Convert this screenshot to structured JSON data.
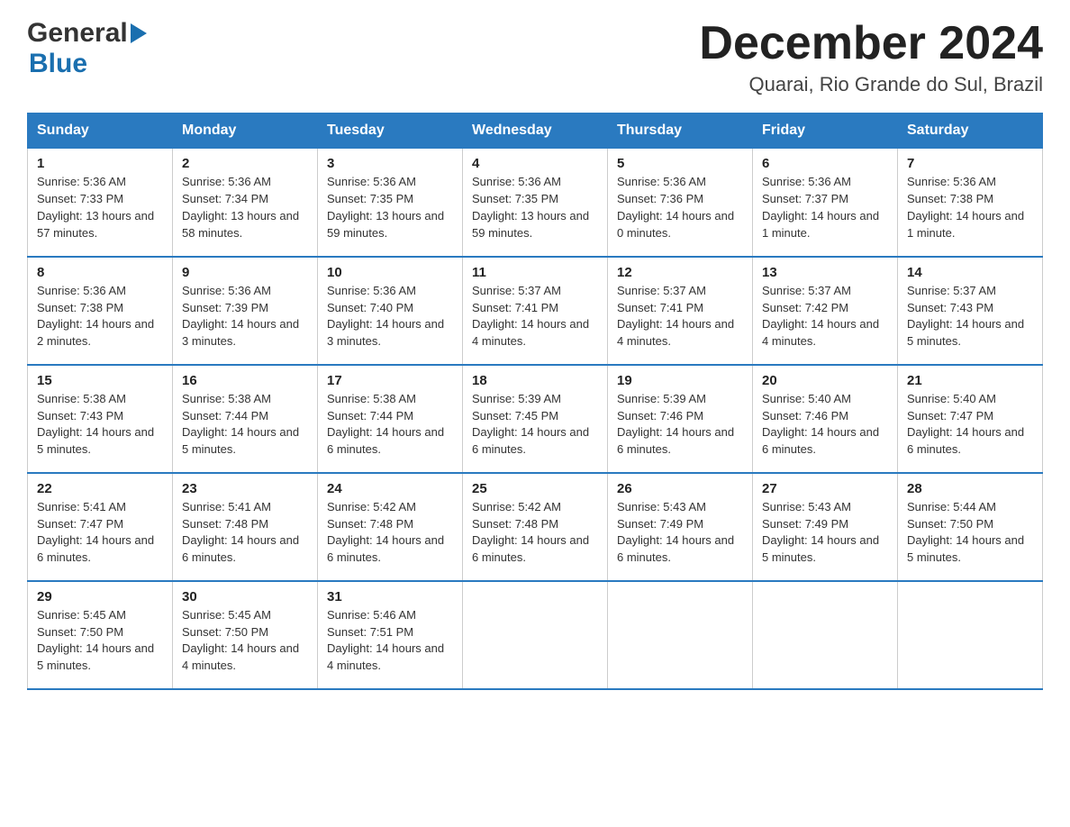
{
  "header": {
    "logo_general": "General",
    "logo_blue": "Blue",
    "month_title": "December 2024",
    "location": "Quarai, Rio Grande do Sul, Brazil"
  },
  "days_of_week": [
    "Sunday",
    "Monday",
    "Tuesday",
    "Wednesday",
    "Thursday",
    "Friday",
    "Saturday"
  ],
  "weeks": [
    [
      {
        "day": "1",
        "sunrise": "5:36 AM",
        "sunset": "7:33 PM",
        "daylight": "13 hours and 57 minutes."
      },
      {
        "day": "2",
        "sunrise": "5:36 AM",
        "sunset": "7:34 PM",
        "daylight": "13 hours and 58 minutes."
      },
      {
        "day": "3",
        "sunrise": "5:36 AM",
        "sunset": "7:35 PM",
        "daylight": "13 hours and 59 minutes."
      },
      {
        "day": "4",
        "sunrise": "5:36 AM",
        "sunset": "7:35 PM",
        "daylight": "13 hours and 59 minutes."
      },
      {
        "day": "5",
        "sunrise": "5:36 AM",
        "sunset": "7:36 PM",
        "daylight": "14 hours and 0 minutes."
      },
      {
        "day": "6",
        "sunrise": "5:36 AM",
        "sunset": "7:37 PM",
        "daylight": "14 hours and 1 minute."
      },
      {
        "day": "7",
        "sunrise": "5:36 AM",
        "sunset": "7:38 PM",
        "daylight": "14 hours and 1 minute."
      }
    ],
    [
      {
        "day": "8",
        "sunrise": "5:36 AM",
        "sunset": "7:38 PM",
        "daylight": "14 hours and 2 minutes."
      },
      {
        "day": "9",
        "sunrise": "5:36 AM",
        "sunset": "7:39 PM",
        "daylight": "14 hours and 3 minutes."
      },
      {
        "day": "10",
        "sunrise": "5:36 AM",
        "sunset": "7:40 PM",
        "daylight": "14 hours and 3 minutes."
      },
      {
        "day": "11",
        "sunrise": "5:37 AM",
        "sunset": "7:41 PM",
        "daylight": "14 hours and 4 minutes."
      },
      {
        "day": "12",
        "sunrise": "5:37 AM",
        "sunset": "7:41 PM",
        "daylight": "14 hours and 4 minutes."
      },
      {
        "day": "13",
        "sunrise": "5:37 AM",
        "sunset": "7:42 PM",
        "daylight": "14 hours and 4 minutes."
      },
      {
        "day": "14",
        "sunrise": "5:37 AM",
        "sunset": "7:43 PM",
        "daylight": "14 hours and 5 minutes."
      }
    ],
    [
      {
        "day": "15",
        "sunrise": "5:38 AM",
        "sunset": "7:43 PM",
        "daylight": "14 hours and 5 minutes."
      },
      {
        "day": "16",
        "sunrise": "5:38 AM",
        "sunset": "7:44 PM",
        "daylight": "14 hours and 5 minutes."
      },
      {
        "day": "17",
        "sunrise": "5:38 AM",
        "sunset": "7:44 PM",
        "daylight": "14 hours and 6 minutes."
      },
      {
        "day": "18",
        "sunrise": "5:39 AM",
        "sunset": "7:45 PM",
        "daylight": "14 hours and 6 minutes."
      },
      {
        "day": "19",
        "sunrise": "5:39 AM",
        "sunset": "7:46 PM",
        "daylight": "14 hours and 6 minutes."
      },
      {
        "day": "20",
        "sunrise": "5:40 AM",
        "sunset": "7:46 PM",
        "daylight": "14 hours and 6 minutes."
      },
      {
        "day": "21",
        "sunrise": "5:40 AM",
        "sunset": "7:47 PM",
        "daylight": "14 hours and 6 minutes."
      }
    ],
    [
      {
        "day": "22",
        "sunrise": "5:41 AM",
        "sunset": "7:47 PM",
        "daylight": "14 hours and 6 minutes."
      },
      {
        "day": "23",
        "sunrise": "5:41 AM",
        "sunset": "7:48 PM",
        "daylight": "14 hours and 6 minutes."
      },
      {
        "day": "24",
        "sunrise": "5:42 AM",
        "sunset": "7:48 PM",
        "daylight": "14 hours and 6 minutes."
      },
      {
        "day": "25",
        "sunrise": "5:42 AM",
        "sunset": "7:48 PM",
        "daylight": "14 hours and 6 minutes."
      },
      {
        "day": "26",
        "sunrise": "5:43 AM",
        "sunset": "7:49 PM",
        "daylight": "14 hours and 6 minutes."
      },
      {
        "day": "27",
        "sunrise": "5:43 AM",
        "sunset": "7:49 PM",
        "daylight": "14 hours and 5 minutes."
      },
      {
        "day": "28",
        "sunrise": "5:44 AM",
        "sunset": "7:50 PM",
        "daylight": "14 hours and 5 minutes."
      }
    ],
    [
      {
        "day": "29",
        "sunrise": "5:45 AM",
        "sunset": "7:50 PM",
        "daylight": "14 hours and 5 minutes."
      },
      {
        "day": "30",
        "sunrise": "5:45 AM",
        "sunset": "7:50 PM",
        "daylight": "14 hours and 4 minutes."
      },
      {
        "day": "31",
        "sunrise": "5:46 AM",
        "sunset": "7:51 PM",
        "daylight": "14 hours and 4 minutes."
      },
      {
        "day": "",
        "sunrise": "",
        "sunset": "",
        "daylight": ""
      },
      {
        "day": "",
        "sunrise": "",
        "sunset": "",
        "daylight": ""
      },
      {
        "day": "",
        "sunrise": "",
        "sunset": "",
        "daylight": ""
      },
      {
        "day": "",
        "sunrise": "",
        "sunset": "",
        "daylight": ""
      }
    ]
  ],
  "labels": {
    "sunrise": "Sunrise:",
    "sunset": "Sunset:",
    "daylight": "Daylight:"
  }
}
